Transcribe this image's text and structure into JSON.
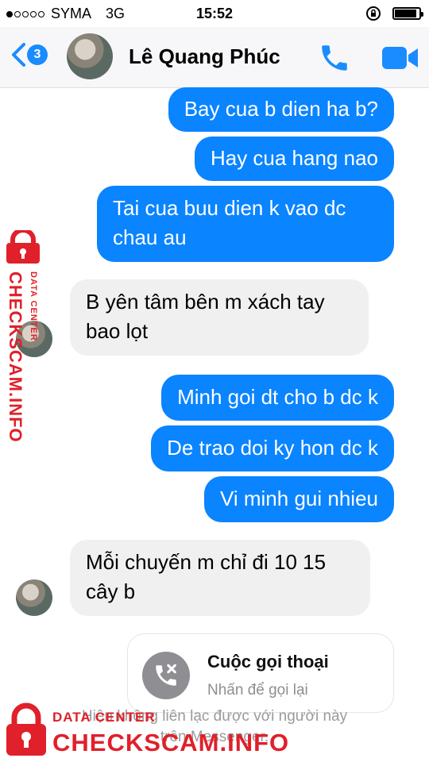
{
  "status_bar": {
    "carrier": "SYMA",
    "network": "3G",
    "time": "15:52",
    "battery_level": 0.85
  },
  "header": {
    "back_badge": "3",
    "contact_name": "Lê Quang Phúc"
  },
  "messages": [
    {
      "dir": "out",
      "text": "Bay cua b dien ha b?"
    },
    {
      "dir": "out",
      "text": "Hay cua hang nao"
    },
    {
      "dir": "out",
      "lines": [
        "Tai cua buu dien k vao dc",
        "chau au"
      ]
    },
    {
      "dir": "in",
      "lines": [
        "B yên tâm bên m xách tay",
        "bao lọt"
      ]
    },
    {
      "dir": "out",
      "text": "Minh goi dt cho b dc k"
    },
    {
      "dir": "out",
      "text": "De trao doi ky hon dc k"
    },
    {
      "dir": "out",
      "text": "Vi minh gui nhieu"
    },
    {
      "dir": "in",
      "lines": [
        "Mỗi chuyến m chỉ đi 10 15",
        "cây b"
      ]
    }
  ],
  "call_card": {
    "title": "Cuộc gọi thoại",
    "subtitle": "Nhấn để gọi lại"
  },
  "notice": {
    "lines": [
      "Hiện không liên lạc được với người này",
      "trên Messenger."
    ]
  },
  "watermark": {
    "small": "DATA CENTER",
    "big": "CHECKSCAM.INFO",
    "color": "#e0202a"
  },
  "colors": {
    "accent": "#1a8cff",
    "outgoing_bubble": "#0a84ff",
    "incoming_bubble": "#f1f0f0"
  },
  "icons": [
    "back-chevron-icon",
    "phone-icon",
    "video-camera-icon",
    "missed-call-icon",
    "lock-icon"
  ]
}
